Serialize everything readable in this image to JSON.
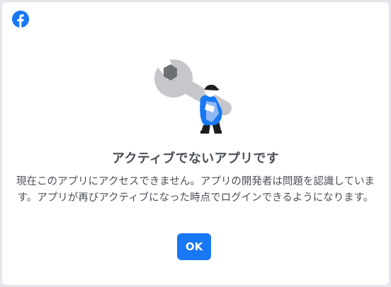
{
  "dialog": {
    "logo_icon": "facebook-logo-icon",
    "illustration_icon": "wrench-worker-illustration",
    "title": "アクティブでないアプリです",
    "message": "現在このアプリにアクセスできません。アプリの開発者は問題を認識しています。アプリが再びアクティブになった時点でログインできるようになります。",
    "ok_label": "OK"
  },
  "colors": {
    "brand": "#1877f2",
    "text": "#4b4f56",
    "background": "#ffffff",
    "page_background": "#e4e6eb"
  }
}
